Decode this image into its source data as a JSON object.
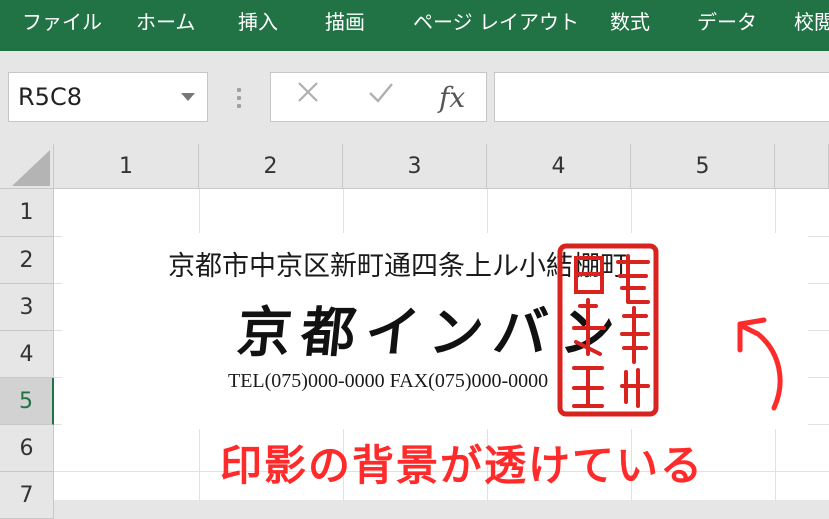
{
  "ribbon": {
    "tabs": [
      "ファイル",
      "ホーム",
      "挿入",
      "描画",
      "ページ レイアウト",
      "数式",
      "データ",
      "校閲"
    ]
  },
  "formula_bar": {
    "name_box": "R5C8",
    "cancel_icon": "close-icon",
    "enter_icon": "check-icon",
    "function_label": "fx",
    "formula": ""
  },
  "sheet": {
    "columns": [
      "1",
      "2",
      "3",
      "4",
      "5"
    ],
    "rows": [
      "1",
      "2",
      "3",
      "4",
      "5",
      "6",
      "7"
    ],
    "active_row": "5"
  },
  "letterhead": {
    "address": "京都市中京区新町通四条上ル小結棚町",
    "company": "京都インバン",
    "contact": "TEL(075)000-0000 FAX(075)000-0000",
    "seal_text": "京都インバン之印",
    "seal_color": "#d8231f"
  },
  "annotation": {
    "text": "印影の背景が透けている",
    "color": "#ff2a2a"
  },
  "colors": {
    "ribbon": "#217346",
    "grid_line": "#e1e1e1",
    "header_bg": "#e6e6e6"
  }
}
